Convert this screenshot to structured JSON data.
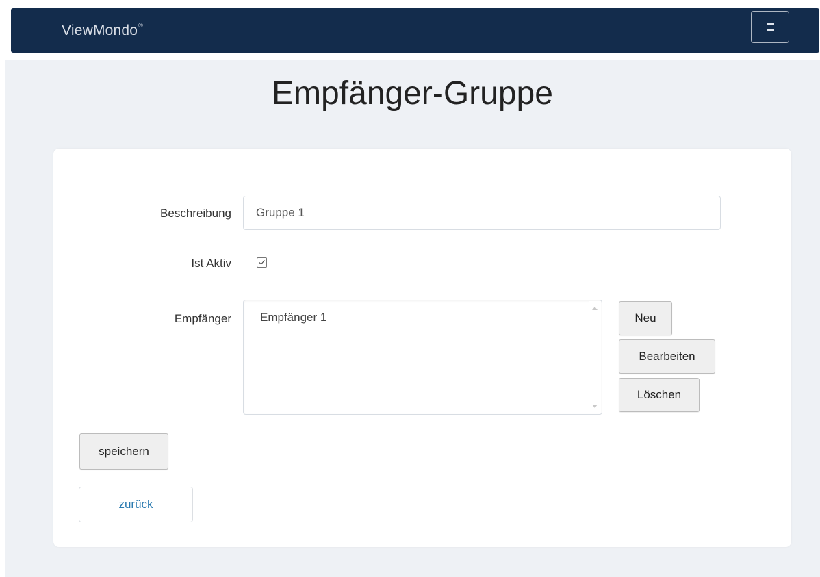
{
  "navbar": {
    "brand": "ViewMondo",
    "brand_mark": "®",
    "menu_icon": "hamburger-icon"
  },
  "page": {
    "title": "Empfänger-Gruppe"
  },
  "form": {
    "beschreibung_label": "Beschreibung",
    "beschreibung_value": "Gruppe 1",
    "ist_aktiv_label": "Ist Aktiv",
    "ist_aktiv_checked": true,
    "empfaenger_label": "Empfänger",
    "empfaenger_items": [
      "Empfänger 1"
    ]
  },
  "buttons": {
    "neu": "Neu",
    "bearbeiten": "Bearbeiten",
    "loeschen": "Löschen",
    "speichern": "speichern",
    "zurueck": "zurück"
  },
  "colors": {
    "navbar": "#132c4c",
    "page_background": "#eef1f5",
    "link": "#2a7ab0"
  }
}
